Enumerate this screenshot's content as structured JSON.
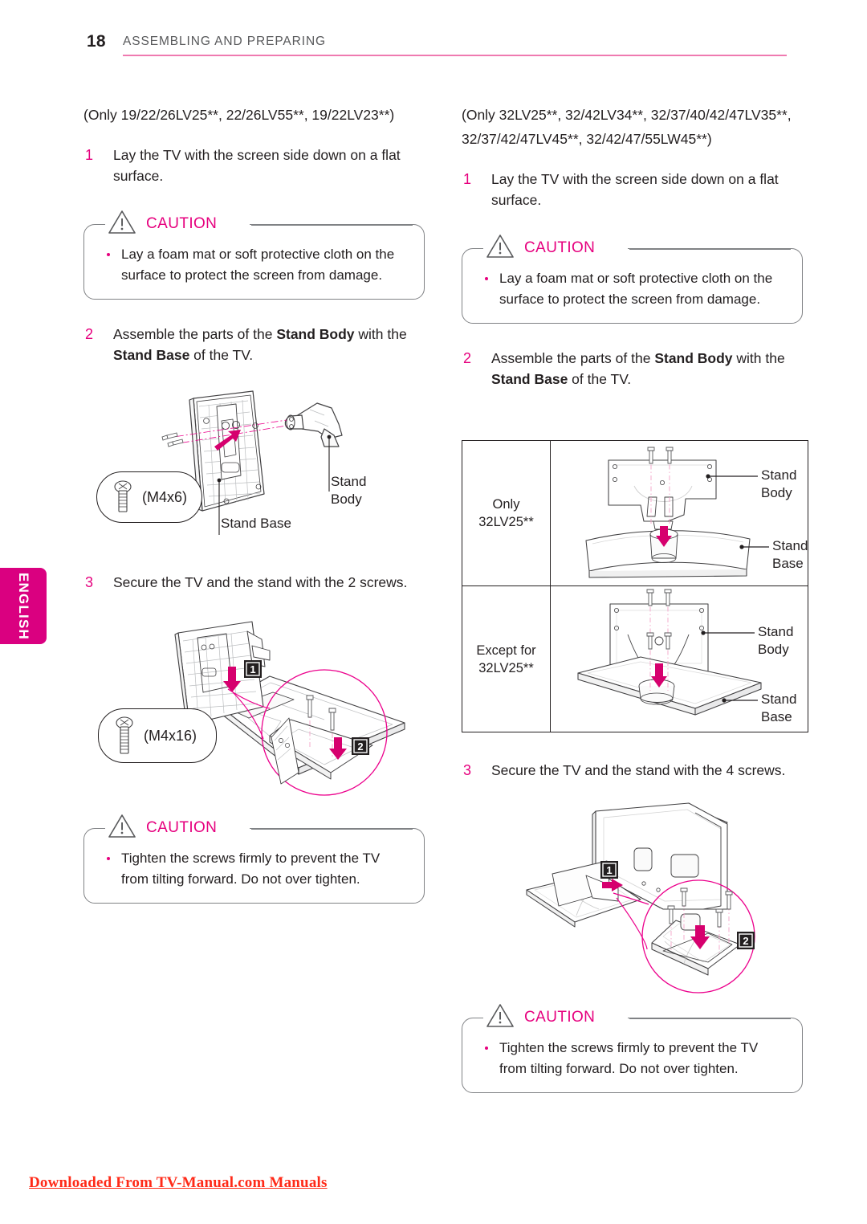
{
  "header": {
    "page_number": "18",
    "title": "ASSEMBLING AND PREPARING",
    "rule_color": "#ef7ab0"
  },
  "side_tab": {
    "label": "ENGLISH",
    "color": "#da0080"
  },
  "accent_color": "#e6007e",
  "left_column": {
    "models": "(Only 19/22/26LV25**, 22/26LV55**, 19/22LV23**)",
    "steps": [
      {
        "number": "1",
        "text": "Lay the TV with the screen side down on a flat surface."
      },
      {
        "number": "2",
        "text_before": "Assemble the parts of the ",
        "bold_1": "Stand Body",
        "text_middle": " with the ",
        "bold_2": "Stand Base",
        "text_after": " of the TV."
      },
      {
        "number": "3",
        "text": "Secure the TV and the stand with the 2 screws."
      }
    ],
    "caution_top": {
      "label": "CAUTION",
      "bullets": [
        "Lay a foam mat or soft protective cloth on the surface to protect the screen from damage."
      ]
    },
    "caution_bottom": {
      "label": "CAUTION",
      "bullets": [
        "Tighten the screws firmly to prevent the TV from tilting forward. Do not over tighten."
      ]
    },
    "figure_stand": {
      "screw_spec": "(M4x6)",
      "label_stand_base": "Stand Base",
      "label_stand_body": "Stand\nBody"
    },
    "figure_secure": {
      "screw_spec": "(M4x16)",
      "marker_1": "1",
      "marker_2": "2"
    }
  },
  "right_column": {
    "models": "(Only 32LV25**, 32/42LV34**, 32/37/40/42/47LV35**, 32/37/42/47LV45**, 32/42/47/55LW45**)",
    "steps": [
      {
        "number": "1",
        "text": "Lay the TV with the screen side down on a flat surface."
      },
      {
        "number": "2",
        "text_before": "Assemble the parts of the ",
        "bold_1": "Stand Body",
        "text_middle": " with the ",
        "bold_2": "Stand Base",
        "text_after": " of the TV."
      },
      {
        "number": "3",
        "text": "Secure the TV and the stand with the 4 screws."
      }
    ],
    "caution": {
      "label": "CAUTION",
      "bullets": [
        "Lay a foam mat or soft protective cloth on the surface to protect the screen from damage."
      ]
    },
    "caution_bottom": {
      "label": "CAUTION",
      "bullets": [
        "Tighten the screws firmly to prevent the TV from tilting forward. Do not over tighten."
      ]
    },
    "stand_table": {
      "rows": [
        {
          "label": "Only\n32LV25**",
          "label_stand_body": "Stand Body",
          "label_stand_base": "Stand Base"
        },
        {
          "label": "Except for\n32LV25**",
          "label_stand_body": "Stand Body",
          "label_stand_base": "Stand Base"
        }
      ]
    },
    "figure_secure": {
      "marker_1": "1",
      "marker_2": "2"
    }
  },
  "footer": {
    "text": "Downloaded From TV-Manual.com Manuals",
    "color": "#ff2a18"
  }
}
